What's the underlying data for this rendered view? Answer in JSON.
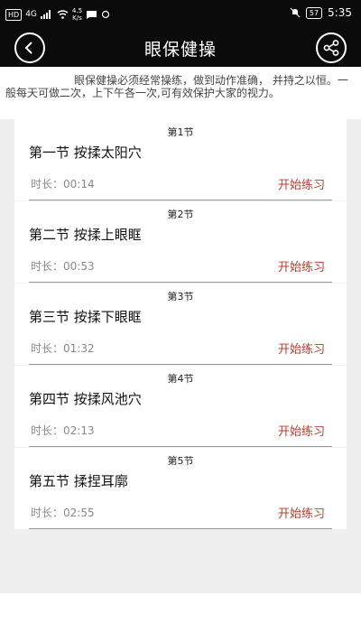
{
  "status_bar": {
    "network": "HD",
    "signal": "4G",
    "speed_value": "4.5",
    "speed_unit": "K/s",
    "battery": "57",
    "time": "5:35"
  },
  "nav": {
    "title": "眼保健操",
    "back_icon": "back-arrow-icon",
    "share_icon": "share-icon"
  },
  "intro_text": "眼保健操必须经常操练，做到动作准确， 并持之以恒。一般每天可做二次，上下午各一次,可有效保护大家的视力。",
  "sections": [
    {
      "header": "第1节",
      "title": "第一节 按揉太阳穴",
      "duration": "时长：00:14",
      "action": "开始练习"
    },
    {
      "header": "第2节",
      "title": "第二节 按揉上眼眶",
      "duration": "时长：00:53",
      "action": "开始练习"
    },
    {
      "header": "第3节",
      "title": "第三节 按揉下眼眶",
      "duration": "时长：01:32",
      "action": "开始练习"
    },
    {
      "header": "第4节",
      "title": "第四节 按揉风池穴",
      "duration": "时长：02:13",
      "action": "开始练习"
    },
    {
      "header": "第5节",
      "title": "第五节 揉捏耳廓",
      "duration": "时长：02:55",
      "action": "开始练习"
    }
  ],
  "colors": {
    "topbar": "#0b0b0b",
    "accent": "#c0392b",
    "background": "#efeeee"
  }
}
